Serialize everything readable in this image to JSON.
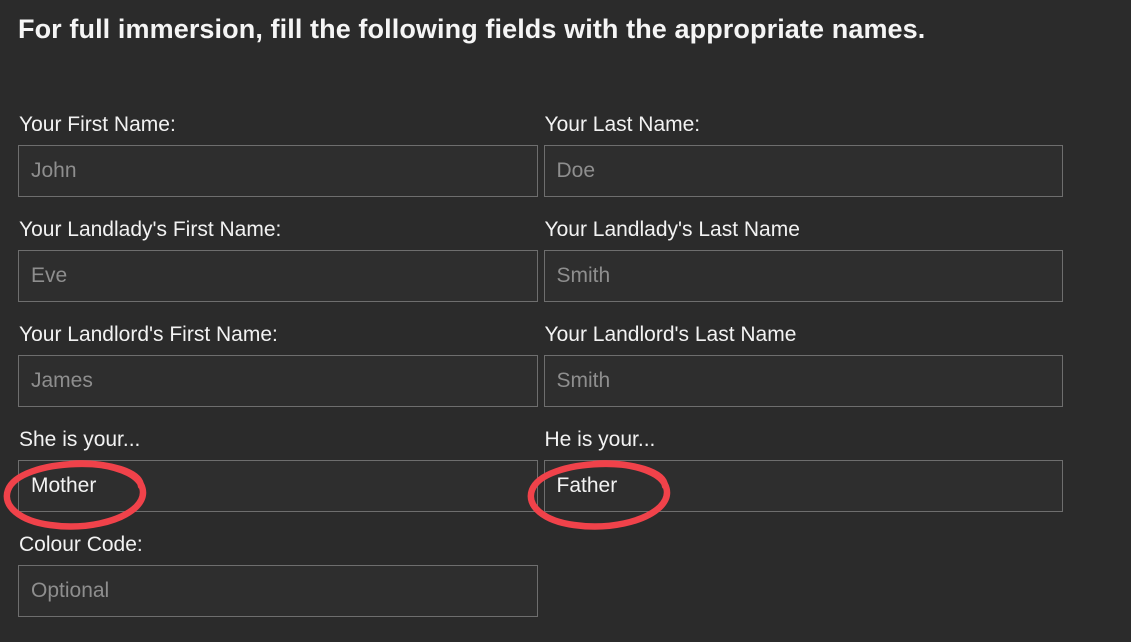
{
  "heading": "For full immersion, fill the following fields with the appropriate names.",
  "colors": {
    "background": "#2b2b2b",
    "text": "#f2f2f2",
    "placeholder": "#8e8e8e",
    "input_border": "#6e6e6e",
    "annotation_red": "#f0424a"
  },
  "form": {
    "rows": [
      {
        "left": {
          "label": "Your First Name:",
          "placeholder": "John",
          "value": ""
        },
        "right": {
          "label": "Your Last Name:",
          "placeholder": "Doe",
          "value": ""
        }
      },
      {
        "left": {
          "label": "Your Landlady's First Name:",
          "placeholder": "Eve",
          "value": ""
        },
        "right": {
          "label": "Your Landlady's Last Name",
          "placeholder": "Smith",
          "value": ""
        }
      },
      {
        "left": {
          "label": "Your Landlord's First Name:",
          "placeholder": "James",
          "value": ""
        },
        "right": {
          "label": "Your Landlord's Last Name",
          "placeholder": "Smith",
          "value": ""
        }
      },
      {
        "left": {
          "label": "She is your...",
          "placeholder": "",
          "value": "Mother"
        },
        "right": {
          "label": "He is your...",
          "placeholder": "",
          "value": "Father"
        }
      },
      {
        "left": {
          "label": "Colour Code:",
          "placeholder": "Optional",
          "value": ""
        },
        "right": null
      }
    ]
  },
  "annotations": [
    {
      "name": "mother-circle",
      "target": "Mother"
    },
    {
      "name": "father-circle",
      "target": "Father"
    }
  ]
}
